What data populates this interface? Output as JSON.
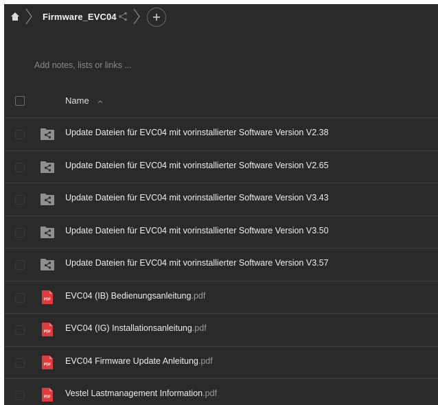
{
  "breadcrumb": {
    "home_icon": "home-icon",
    "folder": "Firmware_EVC04",
    "share_icon": "share-icon",
    "add_icon": "plus-icon"
  },
  "notes": {
    "placeholder": "Add notes, lists or links ..."
  },
  "table": {
    "column_name": "Name",
    "sort": "ascending"
  },
  "files": [
    {
      "type": "shared-folder",
      "name": "Update Dateien für EVC04 mit vorinstallierter Software Version V2.38",
      "ext": ""
    },
    {
      "type": "shared-folder",
      "name": "Update Dateien für EVC04 mit vorinstallierter Software Version V2.65",
      "ext": ""
    },
    {
      "type": "shared-folder",
      "name": "Update Dateien für EVC04 mit vorinstallierter Software Version V3.43",
      "ext": ""
    },
    {
      "type": "shared-folder",
      "name": "Update Dateien für EVC04 mit vorinstallierter Software Version V3.50",
      "ext": ""
    },
    {
      "type": "shared-folder",
      "name": "Update Dateien für EVC04 mit vorinstallierter Software Version V3.57",
      "ext": ""
    },
    {
      "type": "pdf",
      "badge": "PDF",
      "name": "EVC04 (IB) Bedienungsanleitung",
      "ext": ".pdf"
    },
    {
      "type": "pdf",
      "badge": "PDF",
      "name": "EVC04 (IG) Installationsanleitung",
      "ext": ".pdf"
    },
    {
      "type": "pdf",
      "badge": "PDF",
      "name": "EVC04 Firmware Update Anleitung",
      "ext": ".pdf"
    },
    {
      "type": "pdf",
      "badge": "PDF",
      "name": "Vestel Lastmanagement Information",
      "ext": ".pdf"
    }
  ],
  "colors": {
    "background": "#2a2a2a",
    "folder": "#8f8f8f",
    "pdf": "#e0393e",
    "text": "#ececec",
    "muted": "#8a8a8a"
  }
}
